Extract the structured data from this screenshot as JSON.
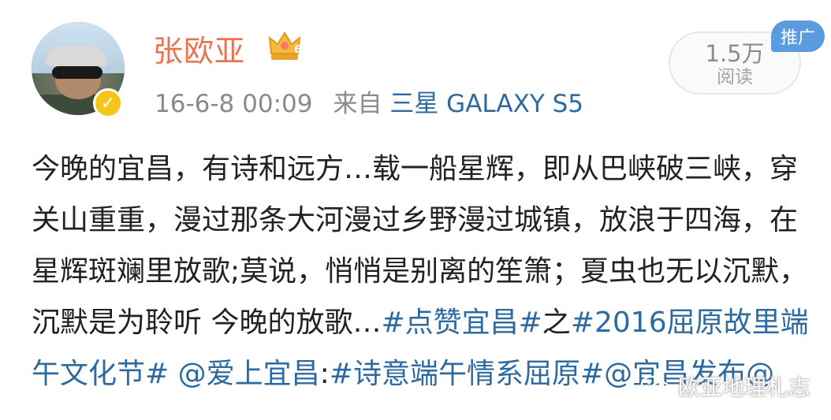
{
  "user": {
    "name": "张欧亚",
    "badge_level": "6",
    "verified_mark": "✓"
  },
  "meta": {
    "time": "16-6-8 00:09",
    "source_prefix": "来自",
    "device": "三星 GALAXY S5"
  },
  "stats": {
    "reads_count": "1.5万",
    "reads_label": "阅读",
    "promo_label": "推广"
  },
  "post": {
    "text": "今晚的宜昌，有诗和远方…载一船星辉，即从巴峡破三峡，穿关山重重，漫过那条大河漫过乡野漫过城镇，放浪于四海，在星辉斑斓里放歌;莫说，悄悄是别离的笙箫；夏虫也无以沉默，沉默是为聆听 今晚的放歌…",
    "hashtag1": "#点赞宜昌#",
    "connector": "之",
    "hashtag2": "#2016屈原故里端午文化节#",
    "mention1": "@爱上宜昌",
    "colon": ":",
    "hashtag3": "#诗意端午情系屈原#",
    "mention2": "@宜昌发布@"
  },
  "watermark": {
    "text": "欧亚地理札志"
  },
  "colors": {
    "username": "#eb7350",
    "link": "#2c6aa0",
    "meta": "#8a8a8a",
    "promo": "#5b9be0",
    "verified": "#f5c518"
  },
  "icons": [
    "verified-icon",
    "vip-crown-icon",
    "wechat-icon"
  ]
}
